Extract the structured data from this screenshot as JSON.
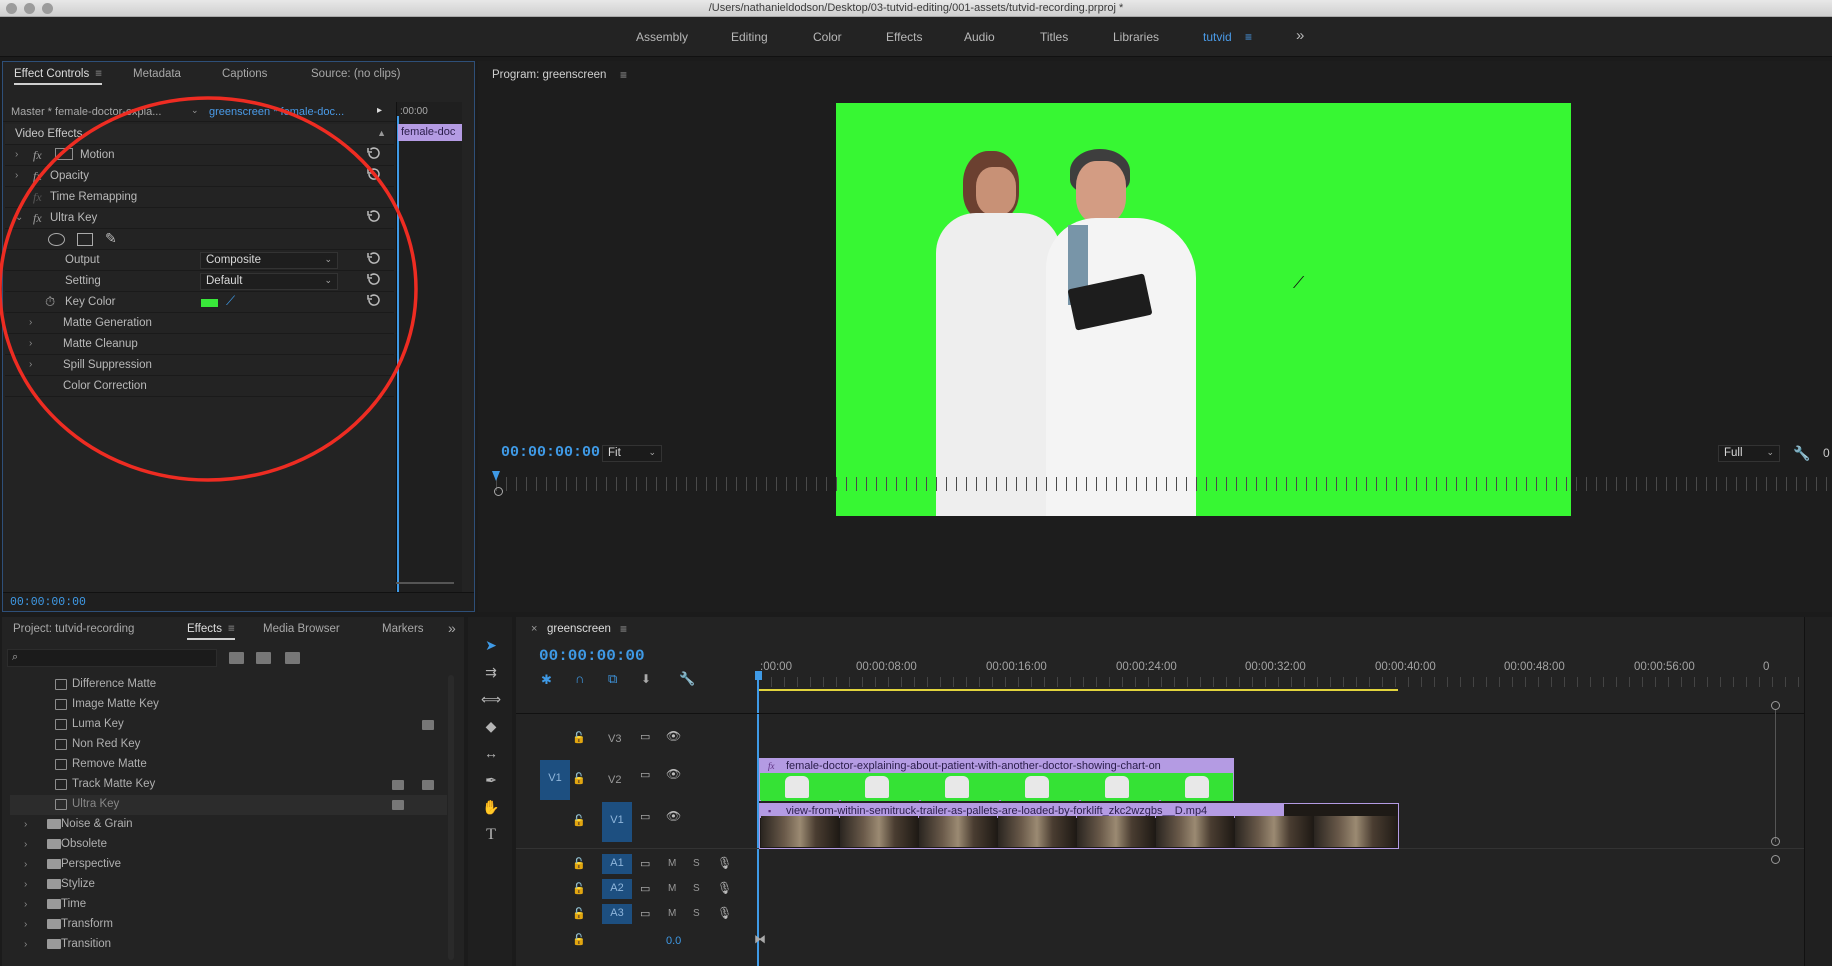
{
  "window": {
    "path_title": "/Users/nathanieldodson/Desktop/03-tutvid-editing/001-assets/tutvid-recording.prproj *"
  },
  "workspaces": [
    {
      "label": "Assembly",
      "active": false
    },
    {
      "label": "Editing",
      "active": false
    },
    {
      "label": "Color",
      "active": false
    },
    {
      "label": "Effects",
      "active": false
    },
    {
      "label": "Audio",
      "active": false
    },
    {
      "label": "Titles",
      "active": false
    },
    {
      "label": "Libraries",
      "active": false
    },
    {
      "label": "tutvid",
      "active": true
    }
  ],
  "workspaces_more": "»",
  "effect_controls": {
    "tabs": {
      "effect_controls": "Effect Controls",
      "metadata": "Metadata",
      "captions": "Captions",
      "source": "Source: (no clips)"
    },
    "master_clip": "Master * female-doctor-expla...",
    "sequence_clip": "greenscreen * female-doc...",
    "mini_timecode": ":00:00",
    "mini_clip_label": "female-doc",
    "section_title": "Video Effects",
    "effects": {
      "motion": "Motion",
      "opacity": "Opacity",
      "time_remapping": "Time Remapping",
      "ultra_key": "Ultra Key"
    },
    "ultra_key": {
      "output_label": "Output",
      "output_value": "Composite",
      "setting_label": "Setting",
      "setting_value": "Default",
      "key_color_label": "Key Color",
      "key_color": "#39e83a",
      "matte_generation": "Matte Generation",
      "matte_cleanup": "Matte Cleanup",
      "spill_suppression": "Spill Suppression",
      "color_correction": "Color Correction"
    },
    "timecode": "00:00:00:00"
  },
  "program": {
    "title": "Program: greenscreen",
    "timecode": "00:00:00:00",
    "zoom": "Fit",
    "resolution": "Full",
    "trailing": "0",
    "screen_color": "#37f733"
  },
  "project_panel": {
    "tabs": {
      "project": "Project: tutvid-recording",
      "effects": "Effects",
      "media_browser": "Media Browser",
      "markers": "Markers"
    },
    "effect_items": [
      "Difference Matte",
      "Image Matte Key",
      "Luma Key",
      "Non Red Key",
      "Remove Matte",
      "Track Matte Key",
      "Ultra Key"
    ],
    "folders": [
      "Noise & Grain",
      "Obsolete",
      "Perspective",
      "Stylize",
      "Time",
      "Transform",
      "Transition"
    ]
  },
  "timeline": {
    "sequence_name": "greenscreen",
    "timecode": "00:00:00:00",
    "ruler": [
      ":00:00",
      "00:00:08:00",
      "00:00:16:00",
      "00:00:24:00",
      "00:00:32:00",
      "00:00:40:00",
      "00:00:48:00",
      "00:00:56:00",
      "0"
    ],
    "tracks": {
      "v3": "V3",
      "v2": "V2",
      "v1": "V1",
      "v1_target": "V1",
      "a1": "A1",
      "a2": "A2",
      "a3": "A3",
      "m": "M",
      "s": "S",
      "master_volume": "0.0"
    },
    "clip_v2": "female-doctor-explaining-about-patient-with-another-doctor-showing-chart-on",
    "clip_v1": "view-from-within-semitruck-trailer-as-pallets-are-loaded-by-forklift_zkc2wzgbs__D.mp4"
  },
  "colors": {
    "accent_blue": "#3f9ae6",
    "annotation_red": "#ee2c22",
    "clip_purple": "#b49be3"
  }
}
